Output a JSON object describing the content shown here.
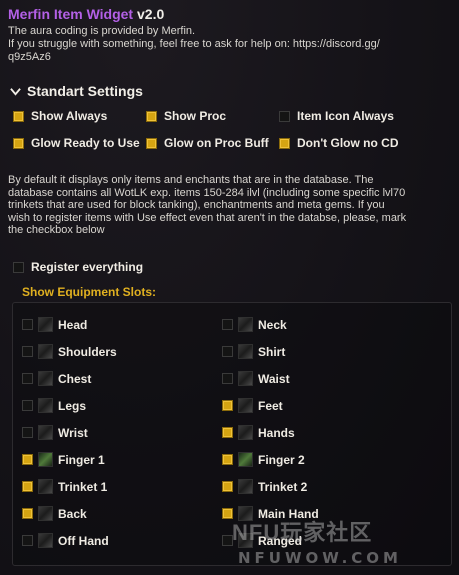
{
  "header": {
    "app_name": "Merfin Item Widget",
    "version": "v2.0",
    "line1": "The aura coding is provided by Merfin.",
    "line2": "If you struggle with something, feel free to ask for help on: https://discord.gg/",
    "line3": "q9z5Az6"
  },
  "standart": {
    "title": "Standart Settings",
    "options": [
      {
        "label": "Show Always",
        "checked": true
      },
      {
        "label": "Show Proc",
        "checked": true
      },
      {
        "label": "Item Icon Always",
        "checked": false
      },
      {
        "label": "Glow Ready to Use",
        "checked": true
      },
      {
        "label": "Glow on Proc Buff",
        "checked": true
      },
      {
        "label": "Don't Glow no CD",
        "checked": true
      }
    ]
  },
  "info": {
    "line1": "By default it displays only items and enchants that are in the database. The",
    "line2": "database contains all WotLK exp. items 150-284 ilvl (including some specific lvl70",
    "line3": "trinkets that are used for block tanking), enchantments and meta gems. If you",
    "line4": "wish to register items with Use effect even that aren't in the databse, please, mark",
    "line5": "the checkbox below"
  },
  "register": {
    "label": "Register everything",
    "checked": false
  },
  "equipment": {
    "title": "Show Equipment Slots:",
    "slots": [
      {
        "label": "Head",
        "checked": false
      },
      {
        "label": "Neck",
        "checked": false
      },
      {
        "label": "Shoulders",
        "checked": false
      },
      {
        "label": "Shirt",
        "checked": false
      },
      {
        "label": "Chest",
        "checked": false
      },
      {
        "label": "Waist",
        "checked": false
      },
      {
        "label": "Legs",
        "checked": false
      },
      {
        "label": "Feet",
        "checked": true
      },
      {
        "label": "Wrist",
        "checked": false
      },
      {
        "label": "Hands",
        "checked": true
      },
      {
        "label": "Finger 1",
        "checked": true
      },
      {
        "label": "Finger 2",
        "checked": true
      },
      {
        "label": "Trinket 1",
        "checked": true
      },
      {
        "label": "Trinket 2",
        "checked": true
      },
      {
        "label": "Back",
        "checked": true
      },
      {
        "label": "Main Hand",
        "checked": true
      },
      {
        "label": "Off Hand",
        "checked": false
      },
      {
        "label": "Ranged",
        "checked": false
      }
    ]
  },
  "watermark": {
    "line1": "NFU玩家社区",
    "line2": "NFUWOW.COM"
  },
  "colors": {
    "accent": "#d6a512",
    "title": "#b360e6",
    "section": "#e0b020"
  }
}
